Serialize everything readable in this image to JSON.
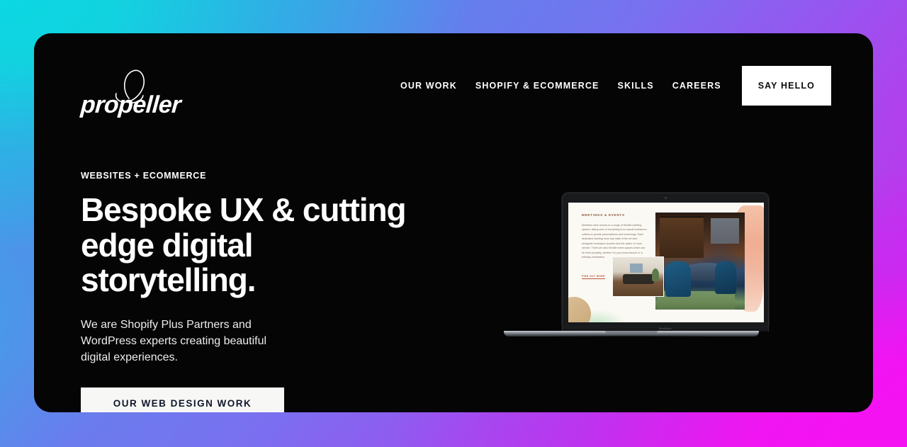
{
  "colors": {
    "gradient_top_left": "#12D2E0",
    "gradient_top_right": "#7B6FF0",
    "gradient_bottom_left": "#7B6FF0",
    "gradient_bottom_mid": "#B03BEC",
    "gradient_bottom_right": "#F512F2",
    "card_background": "#050505",
    "cta_white": "#FFFFFF",
    "cta_text_dark": "#10172B",
    "screen_paper": "#FBF9F4",
    "screen_heading_brown": "#8A5538",
    "screen_link_rust": "#B4543A"
  },
  "header": {
    "logo": {
      "wordmark": "propeller",
      "icon_name": "propeller-blade-icon"
    },
    "nav_items": [
      {
        "label": "OUR WORK",
        "style": "link"
      },
      {
        "label": "SHOPIFY & ECOMMERCE",
        "style": "link"
      },
      {
        "label": "SKILLS",
        "style": "link"
      },
      {
        "label": "CAREERS",
        "style": "link"
      },
      {
        "label": "SAY HELLO",
        "style": "cta"
      }
    ]
  },
  "hero": {
    "eyebrow": "WEBSITES + ECOMMERCE",
    "headline": "Bespoke UX & cutting edge digital storytelling.",
    "subcopy": "We are Shopify Plus Partners and WordPress experts creating beautiful digital experiences.",
    "cta_label": "OUR WEB DESIGN WORK"
  },
  "mockup": {
    "device_label": "MacBook",
    "screen": {
      "heading": "MEETINGS & EVENTS",
      "body": "Members have access to a range of flexible meeting spaces, taking care of everything from casual brainstorm coffees to private presentations and screenings. Each dedicated meeting room has state of the art tech alongside homespun touches and the option of room service. There are also flexible event spaces which can be hired privately, whether for your brand launch or a birthday celebration.",
      "link_label": "FIND OUT MORE"
    }
  }
}
